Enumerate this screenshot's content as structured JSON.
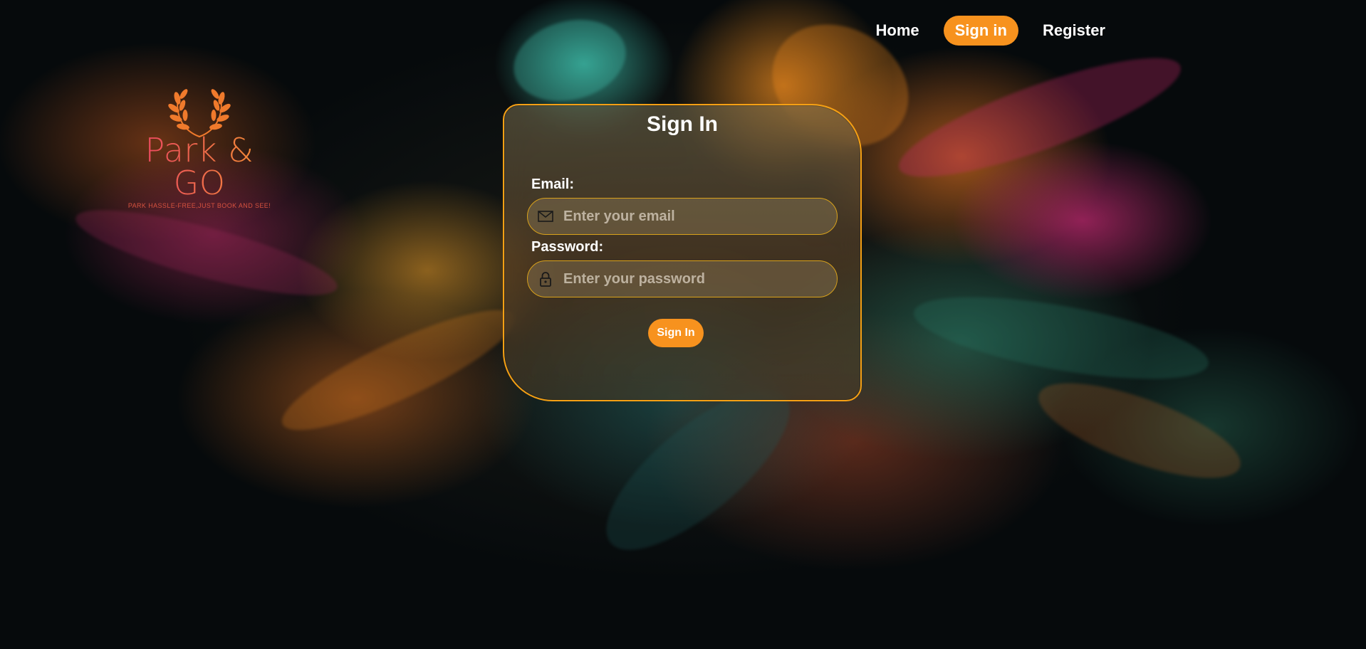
{
  "nav": {
    "items": [
      {
        "label": "Home",
        "active": false
      },
      {
        "label": "Sign in",
        "active": true
      },
      {
        "label": "Register",
        "active": false
      }
    ]
  },
  "logo": {
    "title": "Park & GO",
    "tagline": "PARK HASSLE-FREE,JUST BOOK AND SEE!"
  },
  "signin": {
    "title": "Sign In",
    "email": {
      "label": "Email:",
      "placeholder": "Enter your email",
      "value": "",
      "icon": "envelope-icon"
    },
    "password": {
      "label": "Password:",
      "placeholder": "Enter your password",
      "value": "",
      "icon": "lock-icon"
    },
    "submit_label": "Sign In"
  },
  "colors": {
    "accent": "#f7921e",
    "card_border": "#f5a014",
    "field_border": "#d9a21b",
    "logo_gradient_start": "#e8386b",
    "logo_gradient_end": "#f79a2c"
  }
}
